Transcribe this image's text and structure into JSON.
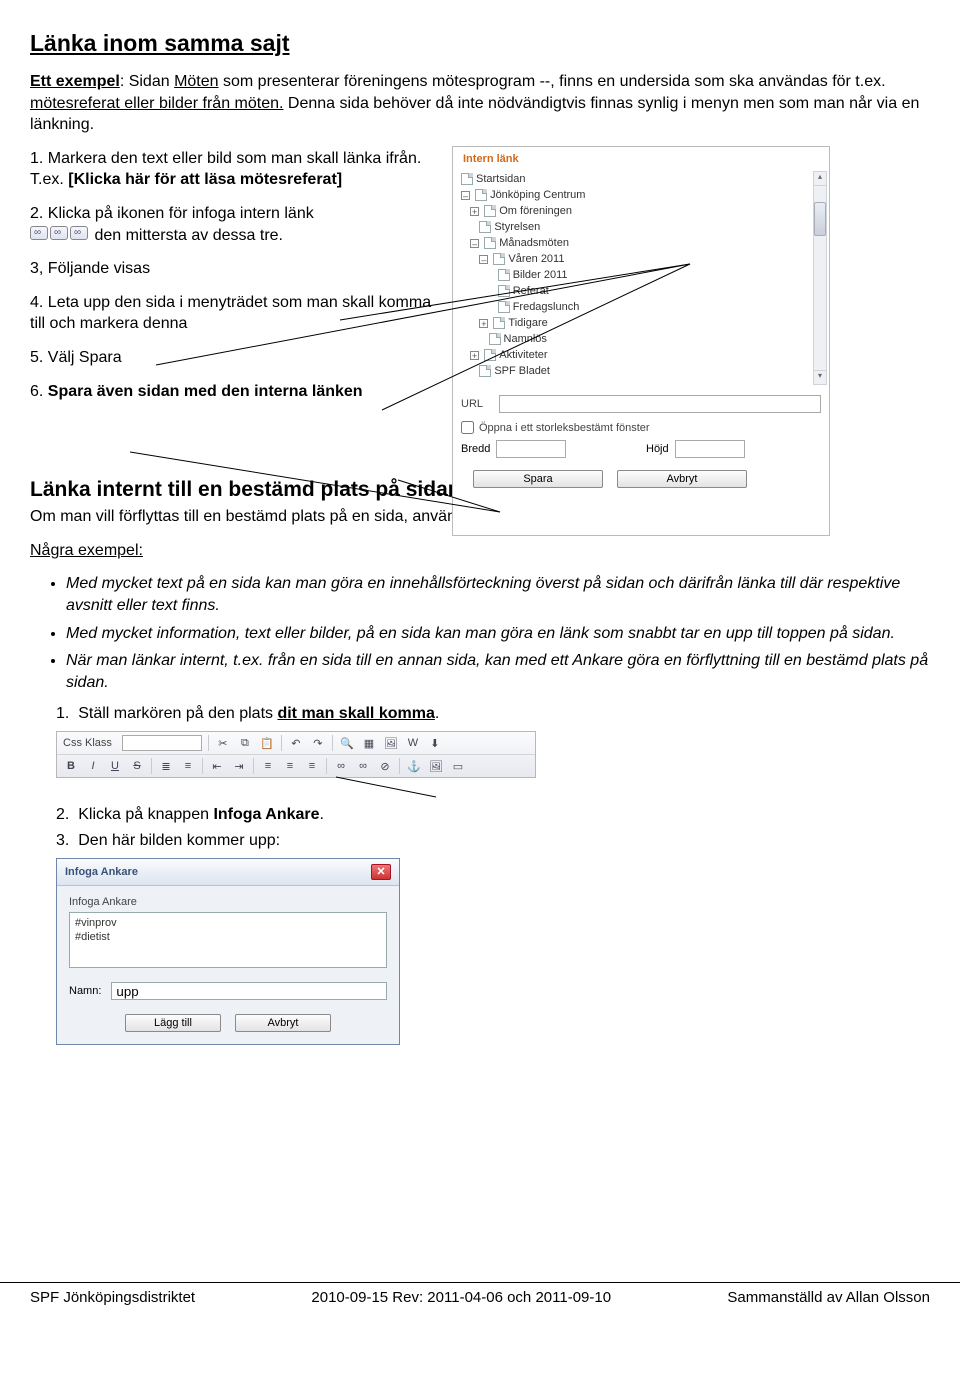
{
  "h1": "Länka inom samma sajt",
  "intro": {
    "lead": "Ett exempel",
    "ref1": "Möten",
    "body1": ": Sidan ",
    "body2": " som presenterar föreningens mötesprogram --, finns en undersida som ska användas för t.ex. ",
    "ref2": "mötesreferat eller bilder från möten.",
    "body3": " Denna sida behöver då inte nödvändigtvis finnas synlig i menyn men som man når via en länkning."
  },
  "steps": {
    "s1a": "1. Markera den text eller bild som man skall länka ifrån. T.ex. ",
    "s1b": "[Klicka här för att läsa mötesreferat]",
    "s2": "2. Klicka på ikonen för infoga intern länk",
    "s2b": "den mittersta av dessa tre.",
    "s3": "3, Följande visas",
    "s4": "4. Leta upp den sida i menyträdet som man skall komma till och markera denna",
    "s5": "5. Välj Spara",
    "s6a": "6. ",
    "s6b": "Spara även sidan med den interna länken"
  },
  "panel": {
    "title": "Intern länk",
    "tree": [
      "Startsidan",
      "Jönköping Centrum",
      "Om föreningen",
      "Styrelsen",
      "Månadsmöten",
      "Våren 2011",
      "Bilder 2011",
      "Referat",
      "Fredagslunch",
      "Tidigare",
      "Namnlös",
      "Aktiviteter",
      "SPF Bladet"
    ],
    "url": "URL",
    "chk": "Öppna i ett storleksbestämt fönster",
    "bredd": "Bredd",
    "hojd": "Höjd",
    "save": "Spara",
    "cancel": "Avbryt"
  },
  "h2": "Länka internt till en bestämd plats på sidan.",
  "intro2": "Om man vill förflyttas till en bestämd plats på en sida, använder man Ankare.",
  "exlabel": "Några exempel:",
  "bullets": [
    "Med mycket text på en sida kan man göra en innehållsförteckning överst på sidan och därifrån länka till där respektive avsnitt eller text finns.",
    "Med mycket information, text eller bilder, på en sida kan man göra en länk som snabbt tar en upp till toppen på sidan.",
    {
      "pre": "När man länkar internt, t.ex. ",
      "ital": "från en sida till en annan sida, kan med ett Ankare göra en förflyttning till en bestämd plats på sidan."
    }
  ],
  "ank": {
    "n1a": "Ställ markören på den plats ",
    "n1b": "dit man skall komma",
    "n2a": "Klicka på knappen ",
    "n2b": "Infoga Ankare",
    "n3": "Den här bilden kommer upp:"
  },
  "toolbar": {
    "label": "Css Klass",
    "b": "B",
    "i": "I",
    "u": "U",
    "s": "S"
  },
  "dialog": {
    "title": "Infoga Ankare",
    "boxlabel": "Infoga Ankare",
    "items": [
      "#vinprov",
      "#dietist"
    ],
    "namn": "Namn:",
    "val": "upp",
    "add": "Lägg till",
    "cancel": "Avbryt"
  },
  "footer": {
    "left": "SPF Jönköpingsdistriktet",
    "center": "2010-09-15  Rev: 2011-04-06 och 2011-09-10",
    "right": "Sammanställd av Allan Olsson"
  }
}
